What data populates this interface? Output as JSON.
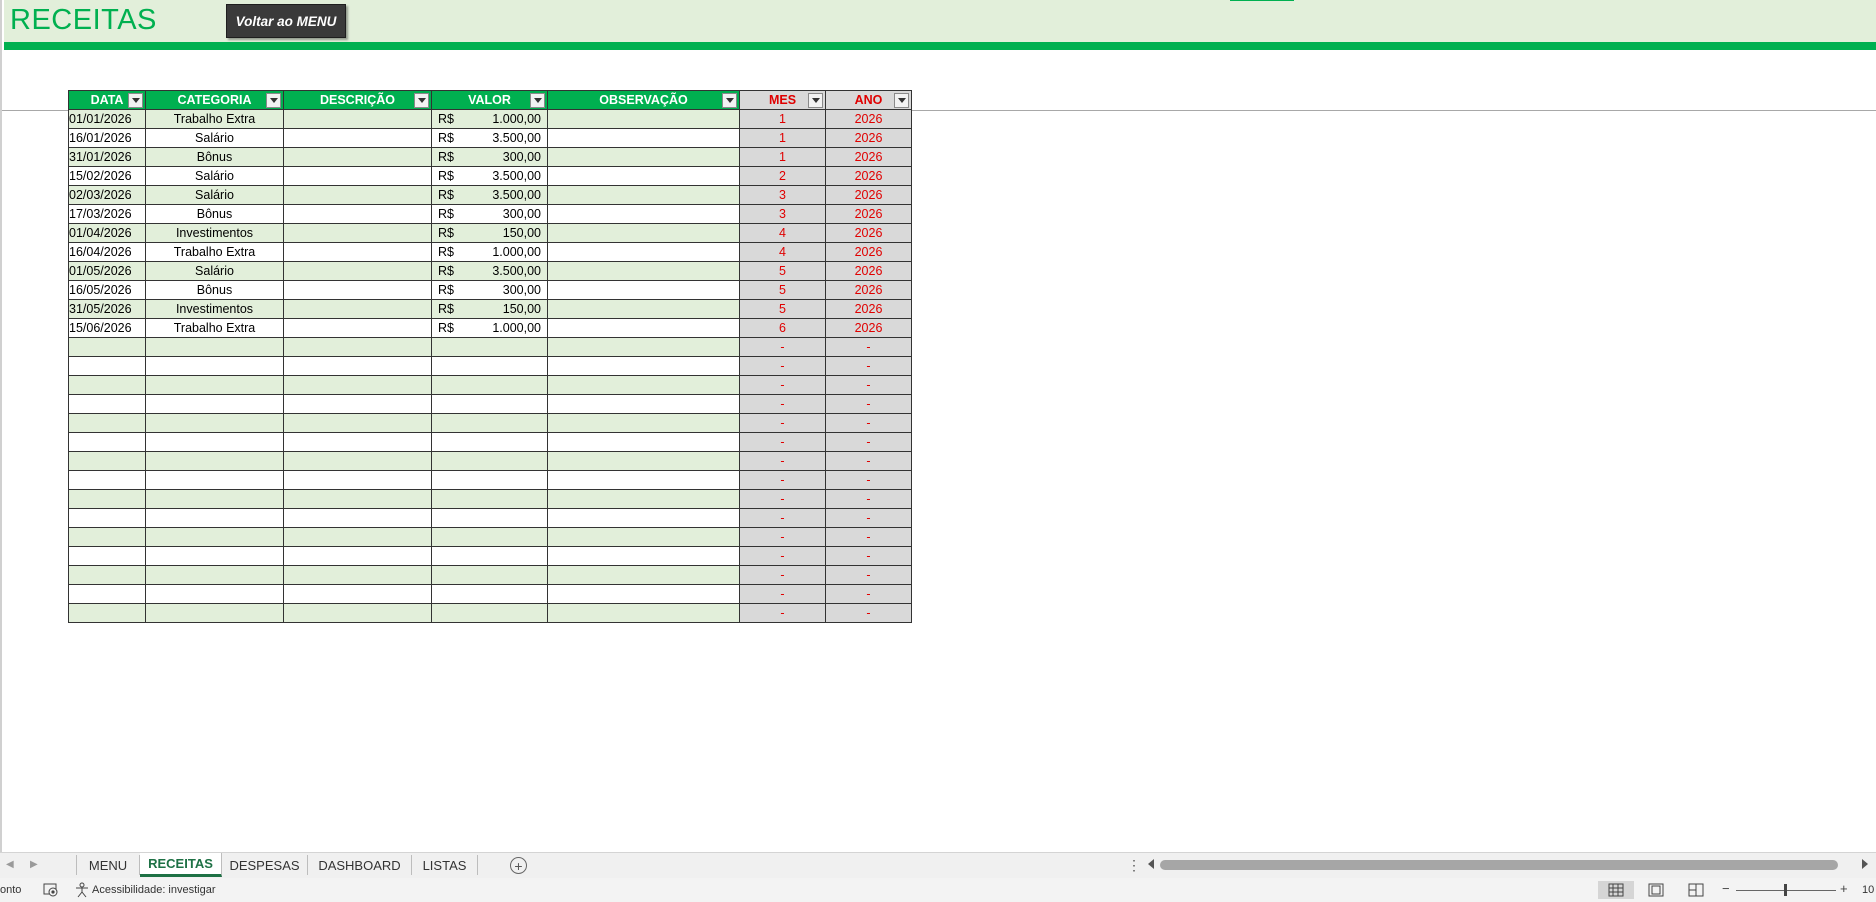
{
  "header": {
    "title": "RECEITAS",
    "menu_button": "Voltar ao MENU"
  },
  "table": {
    "columns": [
      "DATA",
      "CATEGORIA",
      "DESCRIÇÃO",
      "VALOR",
      "OBSERVAÇÃO",
      "MES",
      "ANO"
    ],
    "currency": "R$",
    "rows": [
      {
        "data": "01/01/2026",
        "categoria": "Trabalho Extra",
        "descricao": "",
        "valor": "1.000,00",
        "observacao": "",
        "mes": "1",
        "ano": "2026"
      },
      {
        "data": "16/01/2026",
        "categoria": "Salário",
        "descricao": "",
        "valor": "3.500,00",
        "observacao": "",
        "mes": "1",
        "ano": "2026"
      },
      {
        "data": "31/01/2026",
        "categoria": "Bônus",
        "descricao": "",
        "valor": "300,00",
        "observacao": "",
        "mes": "1",
        "ano": "2026"
      },
      {
        "data": "15/02/2026",
        "categoria": "Salário",
        "descricao": "",
        "valor": "3.500,00",
        "observacao": "",
        "mes": "2",
        "ano": "2026"
      },
      {
        "data": "02/03/2026",
        "categoria": "Salário",
        "descricao": "",
        "valor": "3.500,00",
        "observacao": "",
        "mes": "3",
        "ano": "2026"
      },
      {
        "data": "17/03/2026",
        "categoria": "Bônus",
        "descricao": "",
        "valor": "300,00",
        "observacao": "",
        "mes": "3",
        "ano": "2026"
      },
      {
        "data": "01/04/2026",
        "categoria": "Investimentos",
        "descricao": "",
        "valor": "150,00",
        "observacao": "",
        "mes": "4",
        "ano": "2026"
      },
      {
        "data": "16/04/2026",
        "categoria": "Trabalho Extra",
        "descricao": "",
        "valor": "1.000,00",
        "observacao": "",
        "mes": "4",
        "ano": "2026"
      },
      {
        "data": "01/05/2026",
        "categoria": "Salário",
        "descricao": "",
        "valor": "3.500,00",
        "observacao": "",
        "mes": "5",
        "ano": "2026"
      },
      {
        "data": "16/05/2026",
        "categoria": "Bônus",
        "descricao": "",
        "valor": "300,00",
        "observacao": "",
        "mes": "5",
        "ano": "2026"
      },
      {
        "data": "31/05/2026",
        "categoria": "Investimentos",
        "descricao": "",
        "valor": "150,00",
        "observacao": "",
        "mes": "5",
        "ano": "2026"
      },
      {
        "data": "15/06/2026",
        "categoria": "Trabalho Extra",
        "descricao": "",
        "valor": "1.000,00",
        "observacao": "",
        "mes": "6",
        "ano": "2026"
      }
    ],
    "empty_rows": 15,
    "empty_placeholder": "-"
  },
  "sheet_tabs": [
    {
      "label": "MENU",
      "active": false
    },
    {
      "label": "RECEITAS",
      "active": true
    },
    {
      "label": "DESPESAS",
      "active": false
    },
    {
      "label": "DASHBOARD",
      "active": false
    },
    {
      "label": "LISTAS",
      "active": false
    }
  ],
  "status_bar": {
    "mode": "onto",
    "accessibility": "Acessibilidade: investigar",
    "zoom_text": "10"
  },
  "colors": {
    "accent_green": "#00b050",
    "light_green": "#e2efda",
    "header_grey": "#d9d9d9",
    "red_text": "#e00000"
  },
  "icons": [
    "filter-dropdown-icon",
    "add-sheet-icon",
    "accessibility-icon",
    "macro-record-icon",
    "normal-view-icon",
    "page-layout-icon",
    "page-break-icon"
  ]
}
